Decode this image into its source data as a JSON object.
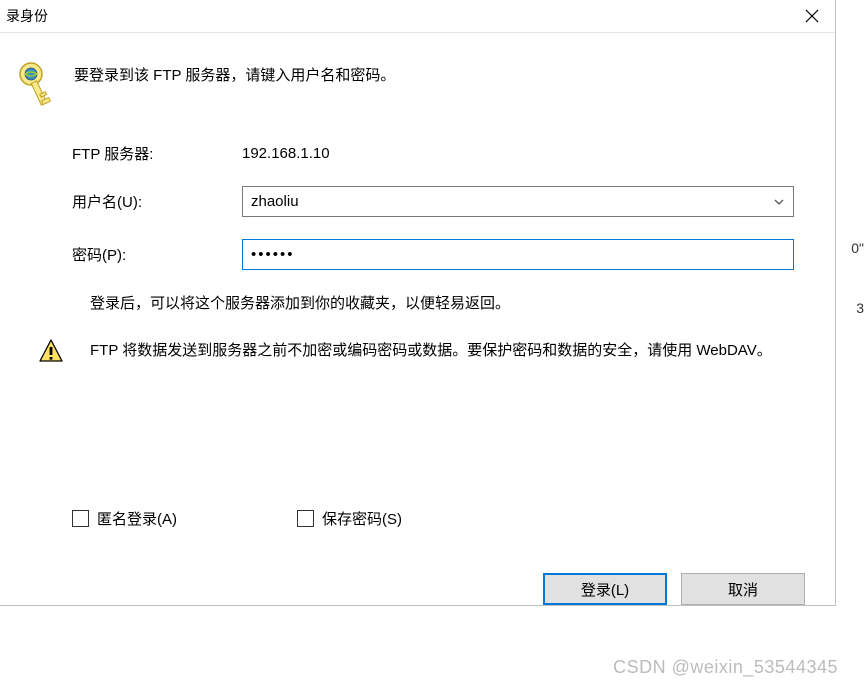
{
  "title": "录身份",
  "instruction": "要登录到该 FTP 服务器，请键入用户名和密码。",
  "server_label": "FTP 服务器:",
  "server_value": "192.168.1.10",
  "username_label": "用户名(U):",
  "username_value": "zhaoliu",
  "password_label": "密码(P):",
  "password_value": "••••••",
  "info_text": "登录后，可以将这个服务器添加到你的收藏夹，以便轻易返回。",
  "warn_text": "FTP 将数据发送到服务器之前不加密或编码密码或数据。要保护密码和数据的安全，请使用 WebDAV。",
  "anon_label": "匿名登录(A)",
  "save_label": "保存密码(S)",
  "login_btn": "登录(L)",
  "cancel_btn": "取消",
  "watermark": "CSDN @weixin_53544345",
  "bg1": "",
  "bg2": "0\"",
  "bg3": "3"
}
